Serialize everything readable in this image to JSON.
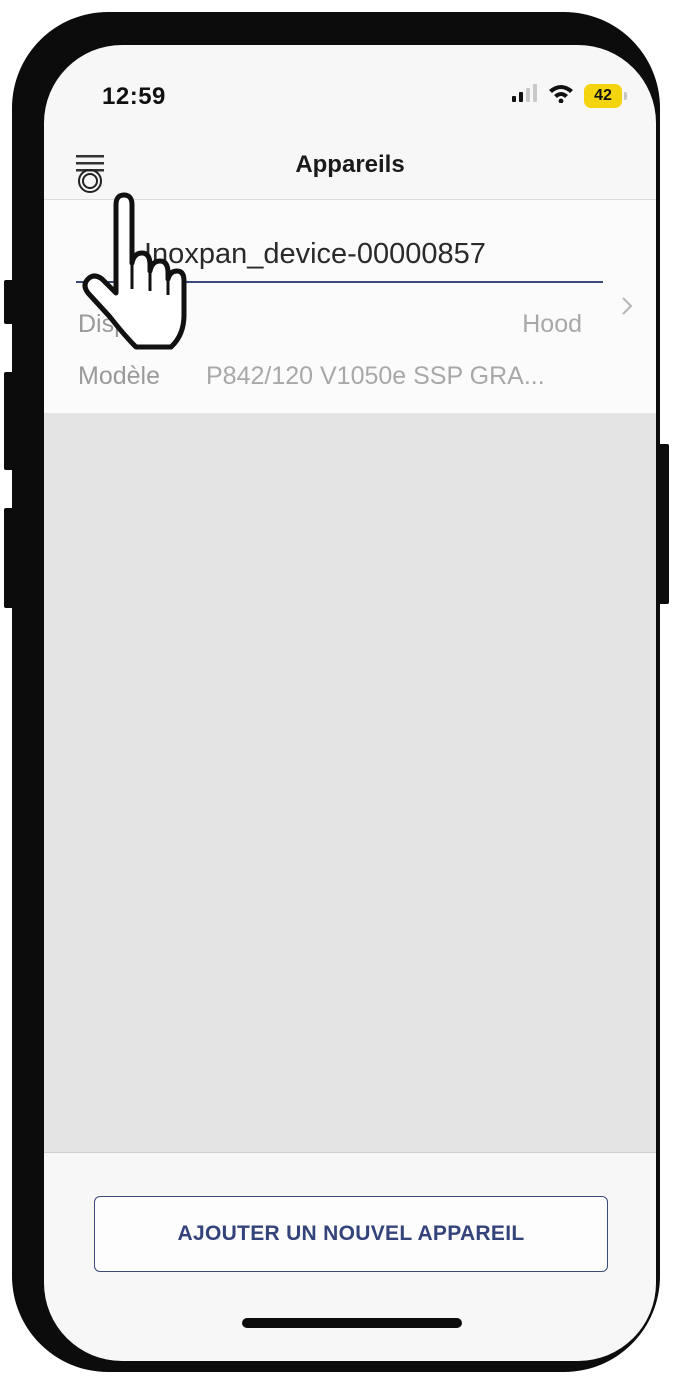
{
  "status_bar": {
    "time": "12:59",
    "battery": "42",
    "battery_color": "#f3d40f"
  },
  "nav": {
    "title": "Appareils",
    "menu_icon": "hamburger-menu-icon"
  },
  "device": {
    "name": "Inoxpan_device-00000857",
    "rows": [
      {
        "label": "Dispositif",
        "value": "Hood"
      },
      {
        "label": "Modèle",
        "value": "P842/120 V1050e SSP GRA..."
      }
    ]
  },
  "footer": {
    "add_button_label": "AJOUTER UN NOUVEL APPAREIL"
  },
  "colors": {
    "accent": "#3b4a78",
    "empty_area": "#e4e4e4"
  }
}
